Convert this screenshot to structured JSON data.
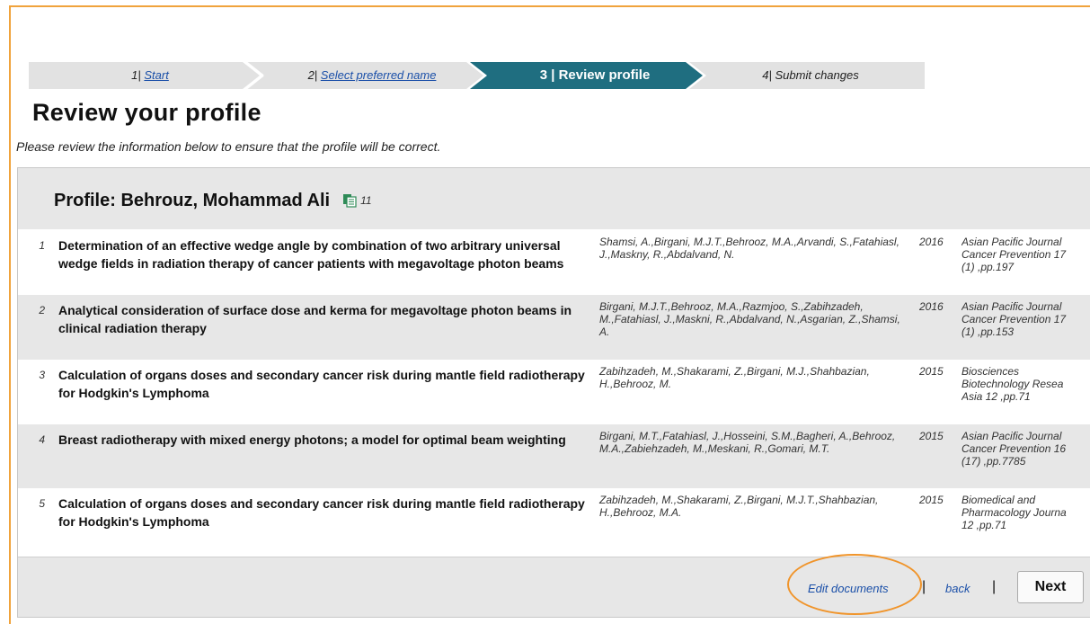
{
  "stepper": {
    "steps": [
      {
        "number": "1",
        "label": "Start"
      },
      {
        "number": "2",
        "label": "Select preferred name"
      },
      {
        "number": "3",
        "label": "Review profile"
      },
      {
        "number": "4",
        "label": "Submit changes"
      }
    ],
    "active_step": 3,
    "colors": {
      "inactive": "#e2e2e2",
      "active": "#1f6e80"
    }
  },
  "page": {
    "title": "Review your profile",
    "subtitle": "Please review the information below to ensure that the profile will be correct."
  },
  "profile": {
    "title": "Profile: Behrouz, Mohammad Ali",
    "doc_count": "11",
    "doc_icon": "documents-icon"
  },
  "documents": [
    {
      "number": "1",
      "title": "Determination of an effective wedge angle by combination of two arbitrary universal wedge fields in radiation therapy of cancer patients with megavoltage photon beams",
      "authors": "Shamsi, A.,Birgani, M.J.T.,Behrooz, M.A.,Arvandi, S.,Fatahiasl, J.,Maskny, R.,Abdalvand, N.",
      "year": "2016",
      "source_lines": [
        "Asian Pacific Journal",
        "Cancer Prevention 17",
        "(1) ,pp.197"
      ]
    },
    {
      "number": "2",
      "title": "Analytical consideration of surface dose and kerma for megavoltage photon beams in clinical radiation therapy",
      "authors": "Birgani, M.J.T.,Behrooz, M.A.,Razmjoo, S.,Zabihzadeh, M.,Fatahiasl, J.,Maskni, R.,Abdalvand, N.,Asgarian, Z.,Shamsi, A.",
      "year": "2016",
      "source_lines": [
        "Asian Pacific Journal",
        "Cancer Prevention 17",
        "(1) ,pp.153"
      ]
    },
    {
      "number": "3",
      "title": "Calculation of organs doses and secondary cancer risk during mantle field radiotherapy for Hodgkin's Lymphoma",
      "authors": "Zabihzadeh, M.,Shakarami, Z.,Birgani, M.J.,Shahbazian, H.,Behrooz, M.",
      "year": "2015",
      "source_lines": [
        "Biosciences",
        "Biotechnology Resea",
        "Asia 12 ,pp.71"
      ]
    },
    {
      "number": "4",
      "title": "Breast radiotherapy with mixed energy photons; a model for optimal beam weighting",
      "authors": "Birgani, M.T.,Fatahiasl, J.,Hosseini, S.M.,Bagheri, A.,Behrooz, M.A.,Zabiehzadeh, M.,Meskani, R.,Gomari, M.T.",
      "year": "2015",
      "source_lines": [
        "Asian Pacific Journal",
        "Cancer Prevention 16",
        "(17) ,pp.7785"
      ]
    },
    {
      "number": "5",
      "title": "Calculation of organs doses and secondary cancer risk during mantle field radiotherapy for Hodgkin's Lymphoma",
      "authors": "Zabihzadeh, M.,Shakarami, Z.,Birgani, M.J.T.,Shahbazian, H.,Behrooz, M.A.",
      "year": "2015",
      "source_lines": [
        "Biomedical and",
        "Pharmacology Journa",
        "12 ,pp.71"
      ]
    }
  ],
  "footer": {
    "edit_label": "Edit documents",
    "separator": "|",
    "back_label": "back",
    "next_label": "Next",
    "highlight_color": "#f0942a"
  }
}
